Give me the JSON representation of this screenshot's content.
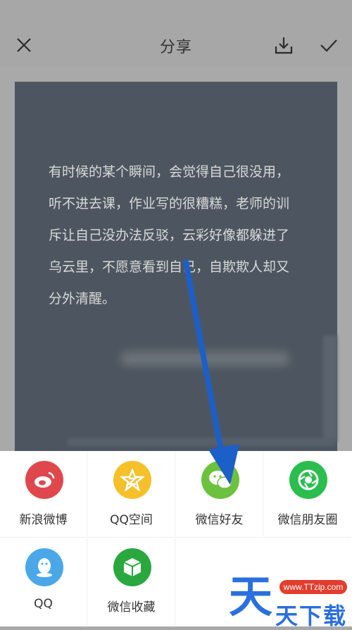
{
  "header": {
    "title": "分享",
    "icons": {
      "close": "close-icon",
      "download": "download-icon",
      "confirm": "check-icon"
    }
  },
  "card": {
    "text": "有时候的某个瞬间，会觉得自己很没用，听不进去课，作业写的很糟糕，老师的训斥让自己没办法反驳，云彩好像都躲进了乌云里，不愿意看到自己，自欺欺人却又分外清醒。"
  },
  "share_options": [
    {
      "label": "新浪微博",
      "icon": "weibo-icon",
      "color": "#e0474c"
    },
    {
      "label": "QQ空间",
      "icon": "qzone-icon",
      "color": "#f5c02a"
    },
    {
      "label": "微信好友",
      "icon": "wechat-icon",
      "color": "#6cc13e"
    },
    {
      "label": "微信朋友圈",
      "icon": "moments-icon",
      "color": "#2bbd4d"
    },
    {
      "label": "QQ",
      "icon": "qq-icon",
      "color": "#4aa8e8"
    },
    {
      "label": "微信收藏",
      "icon": "favorites-icon",
      "color": "#2aa83f"
    }
  ],
  "watermark": {
    "badge": "www.TTzip.com",
    "big_char": "天",
    "small_text": "天下载"
  },
  "colors": {
    "accent_arrow": "#1c5fc8"
  }
}
